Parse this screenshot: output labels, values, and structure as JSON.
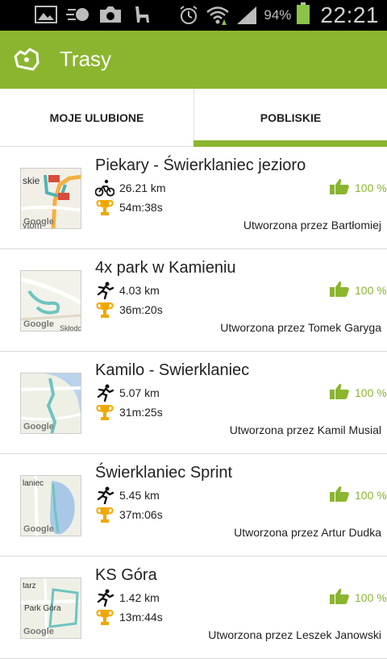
{
  "status_bar": {
    "battery": "94%",
    "time": "22:21",
    "icons": [
      "gallery-icon",
      "speed-icon",
      "camera-icon",
      "llama-icon",
      "alarm-icon",
      "wifi-icon",
      "signal-icon",
      "battery-icon"
    ]
  },
  "app_bar": {
    "title": "Trasy",
    "icon": "map-logo-icon",
    "accent": "#8bb52f"
  },
  "tabs": [
    {
      "label": "MOJE ULUBIONE",
      "selected": false
    },
    {
      "label": "POBLISKIE",
      "selected": true
    }
  ],
  "routes": [
    {
      "title": "Piekary - Świerklaniec jezioro",
      "activity": "cycling-icon",
      "distance": "26.21 km",
      "time": "54m:38s",
      "author": "Utworzona przez Bartłomiej",
      "rating": "100 %",
      "map_label": "Google"
    },
    {
      "title": "4x park w Kamieniu",
      "activity": "running-icon",
      "distance": "4.03 km",
      "time": "36m:20s",
      "author": "Utworzona przez Tomek Garyga",
      "rating": "100 %",
      "map_label": "Google"
    },
    {
      "title": "Kamilo - Swierklaniec",
      "activity": "running-icon",
      "distance": "5.07 km",
      "time": "31m:25s",
      "author": "Utworzona przez Kamil Musial",
      "rating": "100 %",
      "map_label": "Google"
    },
    {
      "title": "Świerklaniec Sprint",
      "activity": "running-icon",
      "distance": "5.45 km",
      "time": "37m:06s",
      "author": "Utworzona przez Artur Dudka",
      "rating": "100 %",
      "map_label": "Google"
    },
    {
      "title": "KS Góra",
      "activity": "running-icon",
      "distance": "1.42 km",
      "time": "13m:44s",
      "author": "Utworzona przez Leszek Janowski",
      "rating": "100 %",
      "map_label": "Google"
    }
  ]
}
